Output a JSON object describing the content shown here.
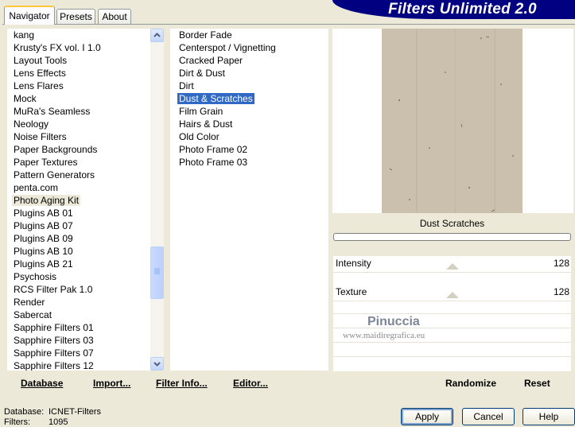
{
  "tabs": [
    {
      "label": "Navigator",
      "active": true
    },
    {
      "label": "Presets",
      "active": false
    },
    {
      "label": "About",
      "active": false
    }
  ],
  "app_title": "Filters Unlimited 2.0",
  "categories": {
    "items": [
      "kang",
      "Krusty's FX vol. I 1.0",
      "Layout Tools",
      "Lens Effects",
      "Lens Flares",
      "Mock",
      "MuRa's Seamless",
      "Neology",
      "Noise Filters",
      "Paper Backgrounds",
      "Paper Textures",
      "Pattern Generators",
      "penta.com",
      "Photo Aging Kit",
      "Plugins AB 01",
      "Plugins AB 07",
      "Plugins AB 09",
      "Plugins AB 10",
      "Plugins AB 21",
      "Psychosis",
      "RCS Filter Pak 1.0",
      "Render",
      "Sabercat",
      "Sapphire Filters 01",
      "Sapphire Filters 03",
      "Sapphire Filters 07",
      "Sapphire Filters 12"
    ],
    "highlighted": "Photo Aging Kit"
  },
  "filters": {
    "items": [
      "Border Fade",
      "Centerspot / Vignetting",
      "Cracked Paper",
      "Dirt & Dust",
      "Dirt",
      "Dust & Scratches",
      "Film Grain",
      "Hairs & Dust",
      "Old Color",
      "Photo Frame 02",
      "Photo Frame 03"
    ],
    "selected": "Dust & Scratches"
  },
  "preview": {
    "filter_label": "Dust  Scratches",
    "colors": {
      "paper": "#cbbfae",
      "progress_border": "#7f7f7f"
    }
  },
  "controls": [
    {
      "label": "Intensity",
      "value": "128",
      "level": 0.5
    },
    {
      "label": "Texture",
      "value": "128",
      "level": 0.5
    }
  ],
  "watermark": {
    "name": "Pinuccia",
    "url": "www.maidiregrafica.eu"
  },
  "toolbar": {
    "database": "Database",
    "import": "Import...",
    "filter_info": "Filter Info...",
    "editor": "Editor...",
    "randomize": "Randomize",
    "reset": "Reset"
  },
  "status": {
    "database_label": "Database:",
    "database_value": "ICNET-Filters",
    "filters_label": "Filters:",
    "filters_value": "1095"
  },
  "dialog_buttons": {
    "apply": "Apply",
    "cancel": "Cancel",
    "help": "Help"
  }
}
